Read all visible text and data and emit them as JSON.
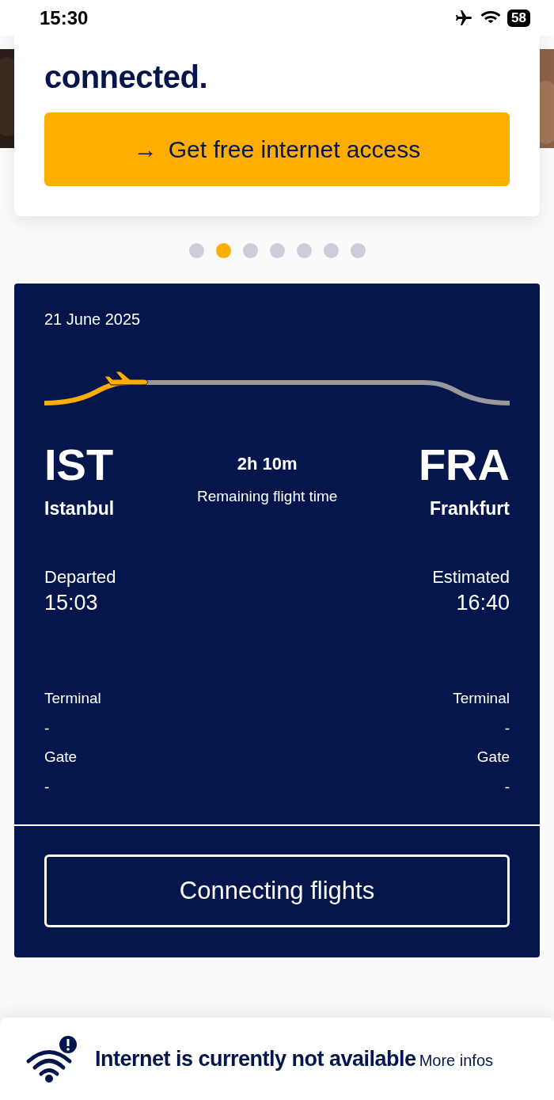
{
  "status_bar": {
    "time": "15:30",
    "airplane_mode": true,
    "battery": "58"
  },
  "promo": {
    "heading": "connected.",
    "button": {
      "icon": "→",
      "label": "Get free internet access"
    }
  },
  "carousel": {
    "dots": [
      {
        "selected": false
      },
      {
        "selected": true
      },
      {
        "selected": false
      },
      {
        "selected": false
      },
      {
        "selected": false
      },
      {
        "selected": false
      },
      {
        "selected": false
      }
    ]
  },
  "flight": {
    "date": "21 June 2025",
    "origin": {
      "code": "IST",
      "city": "Istanbul",
      "status": "Departed",
      "time": "15:03",
      "terminal_label": "Terminal",
      "terminal": "-",
      "gate_label": "Gate",
      "gate": "-"
    },
    "duration": {
      "value": "2h 10m",
      "label": "Remaining flight time"
    },
    "destination": {
      "code": "FRA",
      "city": "Frankfurt",
      "status": "Estimated",
      "time": "16:40",
      "terminal_label": "Terminal",
      "terminal": "-",
      "gate_label": "Gate",
      "gate": "-"
    },
    "button": "Connecting flights"
  },
  "notice": {
    "message": "Internet is currently not available",
    "link": "More infos"
  }
}
